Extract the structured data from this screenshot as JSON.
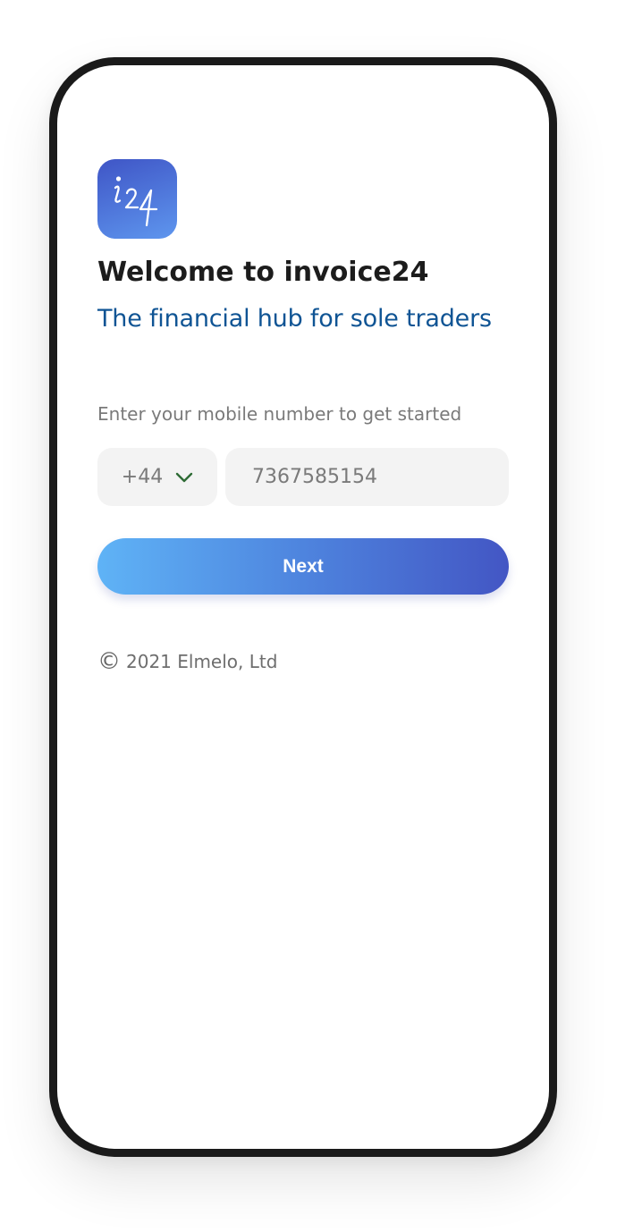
{
  "logo": {
    "icon": "i24-app-logo-icon",
    "text": "i24",
    "colors": [
      "#3f55c6",
      "#5e96ee"
    ]
  },
  "welcome": {
    "title": "Welcome to invoice24",
    "subtitle": "The financial hub for sole traders"
  },
  "form": {
    "prompt": "Enter your mobile number to get started",
    "country_code": "+44",
    "dropdown_icon": "chevron-down-icon",
    "phone_value": "7367585154",
    "next_label": "Next"
  },
  "footer": {
    "copyright_icon": "copyright-icon",
    "copyright_symbol": "©",
    "text": "2021 Elmelo, Ltd"
  },
  "colors": {
    "title": "#1c1c1c",
    "subtitle": "#0f5494",
    "chevron": "#2e6b35",
    "input_bg": "#f3f3f3",
    "button_gradient": [
      "#5fb3f6",
      "#4e84de",
      "#4356c4"
    ]
  }
}
